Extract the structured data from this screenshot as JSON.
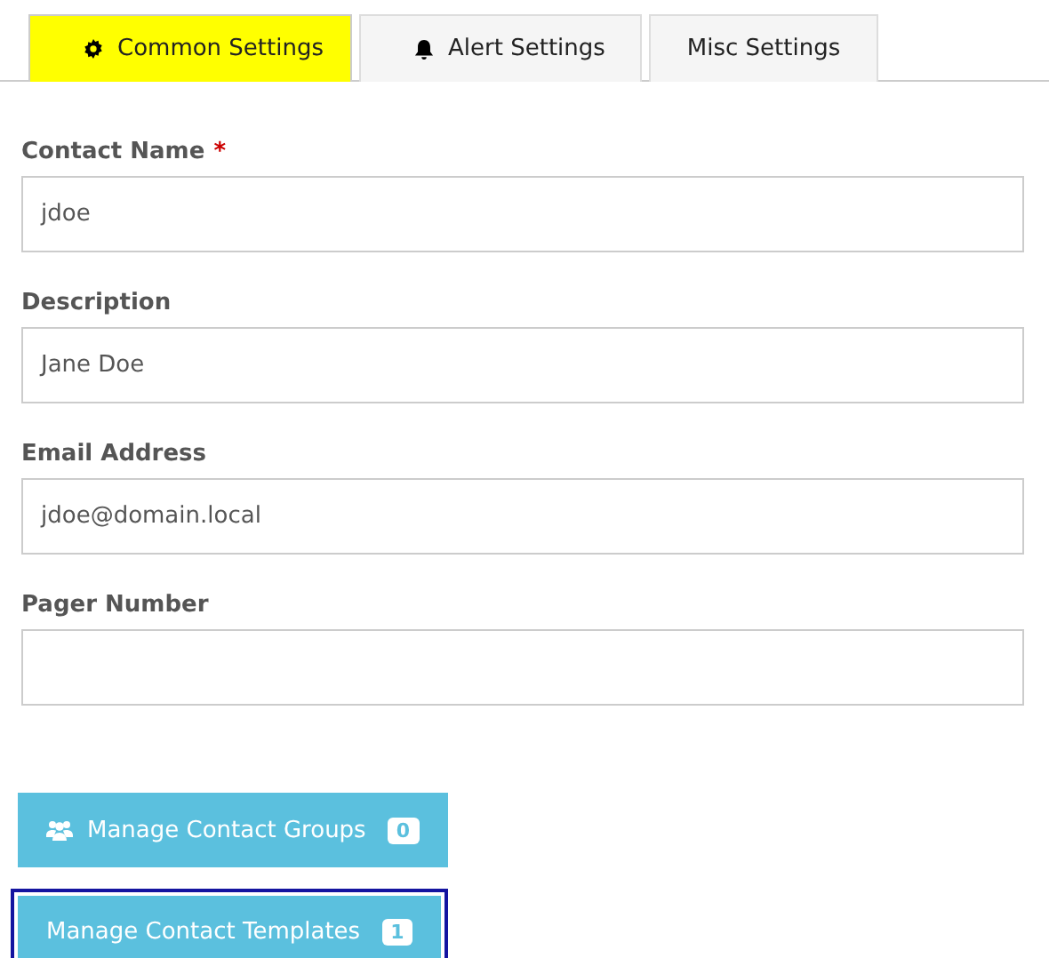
{
  "tabs": [
    {
      "label": "Common Settings",
      "selected": true
    },
    {
      "label": "Alert Settings",
      "selected": false
    },
    {
      "label": "Misc Settings",
      "selected": false
    }
  ],
  "fields": [
    {
      "label": "Contact Name",
      "required_mark": "*",
      "value": "jdoe"
    },
    {
      "label": "Description",
      "value": "Jane Doe"
    },
    {
      "label": "Email Address",
      "value": "jdoe@domain.local"
    },
    {
      "label": "Pager Number"
    }
  ],
  "buttons": [
    {
      "label": "Manage Contact Groups",
      "count": "0",
      "focused": false
    },
    {
      "label": "Manage Contact Templates",
      "count": "1",
      "focused": true
    }
  ]
}
